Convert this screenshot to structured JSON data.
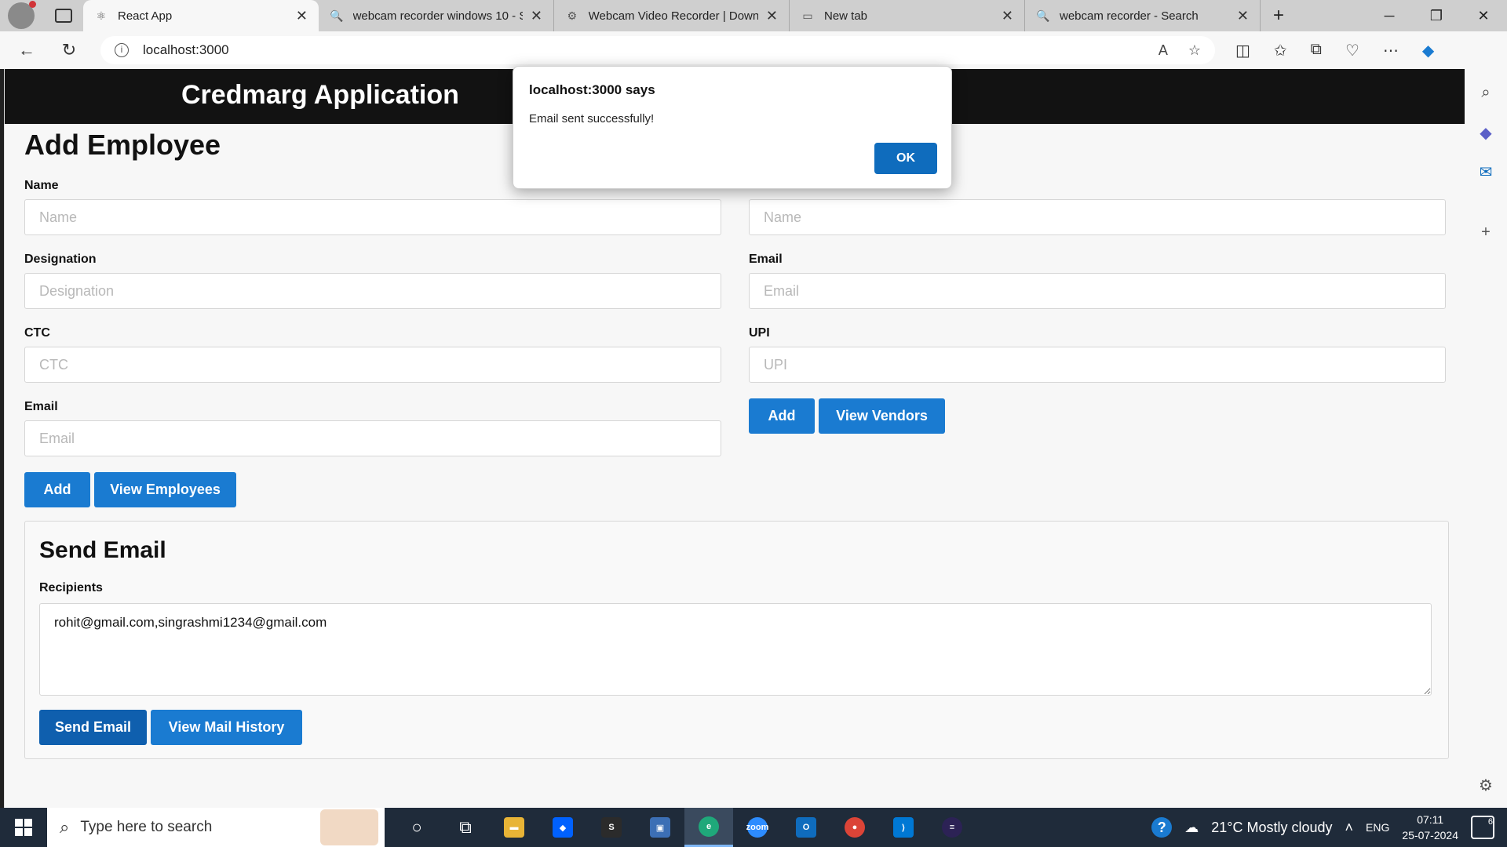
{
  "browser": {
    "tabs": [
      {
        "title": "React App",
        "icon": "react-icon",
        "active": true
      },
      {
        "title": "webcam recorder windows 10 - S",
        "icon": "search-icon",
        "active": false
      },
      {
        "title": "Webcam Video Recorder | Downl",
        "icon": "recorder-icon",
        "active": false
      },
      {
        "title": "New tab",
        "icon": "new-tab-icon",
        "active": false
      },
      {
        "title": "webcam recorder - Search",
        "icon": "search-icon",
        "active": false
      }
    ],
    "url": "localhost:3000"
  },
  "app": {
    "title": "Credmarg Application",
    "page_title": "Add Employee",
    "employee_form": {
      "name_label": "Name",
      "name_placeholder": "Name",
      "designation_label": "Designation",
      "designation_placeholder": "Designation",
      "ctc_label": "CTC",
      "ctc_placeholder": "CTC",
      "email_label": "Email",
      "email_placeholder": "Email",
      "add_label": "Add",
      "view_label": "View Employees"
    },
    "vendor_form": {
      "name_placeholder": "Name",
      "email_label": "Email",
      "email_placeholder": "Email",
      "upi_label": "UPI",
      "upi_placeholder": "UPI",
      "add_label": "Add",
      "view_label": "View Vendors"
    },
    "send_email": {
      "heading": "Send Email",
      "recipients_label": "Recipients",
      "recipients_value": "rohit@gmail.com,singrashmi1234@gmail.com",
      "send_label": "Send Email",
      "history_label": "View Mail History"
    }
  },
  "dialog": {
    "title": "localhost:3000 says",
    "message": "Email sent successfully!",
    "ok_label": "OK"
  },
  "taskbar": {
    "search_placeholder": "Type here to search",
    "weather": "21°C  Mostly cloudy",
    "language": "ENG",
    "time": "07:11",
    "date": "25-07-2024",
    "notification_count": "6"
  },
  "colors": {
    "header_bg": "#121212",
    "button_blue": "#1a7bd1",
    "dialog_button": "#0f6cbd"
  }
}
